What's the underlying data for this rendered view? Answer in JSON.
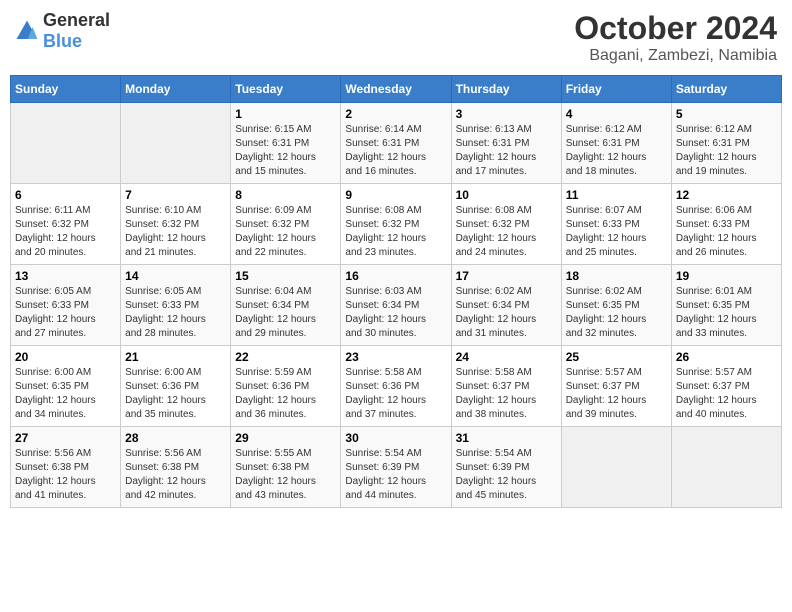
{
  "header": {
    "logo": {
      "text_general": "General",
      "text_blue": "Blue"
    },
    "title": "October 2024",
    "location": "Bagani, Zambezi, Namibia"
  },
  "days_of_week": [
    "Sunday",
    "Monday",
    "Tuesday",
    "Wednesday",
    "Thursday",
    "Friday",
    "Saturday"
  ],
  "weeks": [
    [
      {
        "day": "",
        "detail": ""
      },
      {
        "day": "",
        "detail": ""
      },
      {
        "day": "1",
        "detail": "Sunrise: 6:15 AM\nSunset: 6:31 PM\nDaylight: 12 hours\nand 15 minutes."
      },
      {
        "day": "2",
        "detail": "Sunrise: 6:14 AM\nSunset: 6:31 PM\nDaylight: 12 hours\nand 16 minutes."
      },
      {
        "day": "3",
        "detail": "Sunrise: 6:13 AM\nSunset: 6:31 PM\nDaylight: 12 hours\nand 17 minutes."
      },
      {
        "day": "4",
        "detail": "Sunrise: 6:12 AM\nSunset: 6:31 PM\nDaylight: 12 hours\nand 18 minutes."
      },
      {
        "day": "5",
        "detail": "Sunrise: 6:12 AM\nSunset: 6:31 PM\nDaylight: 12 hours\nand 19 minutes."
      }
    ],
    [
      {
        "day": "6",
        "detail": "Sunrise: 6:11 AM\nSunset: 6:32 PM\nDaylight: 12 hours\nand 20 minutes."
      },
      {
        "day": "7",
        "detail": "Sunrise: 6:10 AM\nSunset: 6:32 PM\nDaylight: 12 hours\nand 21 minutes."
      },
      {
        "day": "8",
        "detail": "Sunrise: 6:09 AM\nSunset: 6:32 PM\nDaylight: 12 hours\nand 22 minutes."
      },
      {
        "day": "9",
        "detail": "Sunrise: 6:08 AM\nSunset: 6:32 PM\nDaylight: 12 hours\nand 23 minutes."
      },
      {
        "day": "10",
        "detail": "Sunrise: 6:08 AM\nSunset: 6:32 PM\nDaylight: 12 hours\nand 24 minutes."
      },
      {
        "day": "11",
        "detail": "Sunrise: 6:07 AM\nSunset: 6:33 PM\nDaylight: 12 hours\nand 25 minutes."
      },
      {
        "day": "12",
        "detail": "Sunrise: 6:06 AM\nSunset: 6:33 PM\nDaylight: 12 hours\nand 26 minutes."
      }
    ],
    [
      {
        "day": "13",
        "detail": "Sunrise: 6:05 AM\nSunset: 6:33 PM\nDaylight: 12 hours\nand 27 minutes."
      },
      {
        "day": "14",
        "detail": "Sunrise: 6:05 AM\nSunset: 6:33 PM\nDaylight: 12 hours\nand 28 minutes."
      },
      {
        "day": "15",
        "detail": "Sunrise: 6:04 AM\nSunset: 6:34 PM\nDaylight: 12 hours\nand 29 minutes."
      },
      {
        "day": "16",
        "detail": "Sunrise: 6:03 AM\nSunset: 6:34 PM\nDaylight: 12 hours\nand 30 minutes."
      },
      {
        "day": "17",
        "detail": "Sunrise: 6:02 AM\nSunset: 6:34 PM\nDaylight: 12 hours\nand 31 minutes."
      },
      {
        "day": "18",
        "detail": "Sunrise: 6:02 AM\nSunset: 6:35 PM\nDaylight: 12 hours\nand 32 minutes."
      },
      {
        "day": "19",
        "detail": "Sunrise: 6:01 AM\nSunset: 6:35 PM\nDaylight: 12 hours\nand 33 minutes."
      }
    ],
    [
      {
        "day": "20",
        "detail": "Sunrise: 6:00 AM\nSunset: 6:35 PM\nDaylight: 12 hours\nand 34 minutes."
      },
      {
        "day": "21",
        "detail": "Sunrise: 6:00 AM\nSunset: 6:36 PM\nDaylight: 12 hours\nand 35 minutes."
      },
      {
        "day": "22",
        "detail": "Sunrise: 5:59 AM\nSunset: 6:36 PM\nDaylight: 12 hours\nand 36 minutes."
      },
      {
        "day": "23",
        "detail": "Sunrise: 5:58 AM\nSunset: 6:36 PM\nDaylight: 12 hours\nand 37 minutes."
      },
      {
        "day": "24",
        "detail": "Sunrise: 5:58 AM\nSunset: 6:37 PM\nDaylight: 12 hours\nand 38 minutes."
      },
      {
        "day": "25",
        "detail": "Sunrise: 5:57 AM\nSunset: 6:37 PM\nDaylight: 12 hours\nand 39 minutes."
      },
      {
        "day": "26",
        "detail": "Sunrise: 5:57 AM\nSunset: 6:37 PM\nDaylight: 12 hours\nand 40 minutes."
      }
    ],
    [
      {
        "day": "27",
        "detail": "Sunrise: 5:56 AM\nSunset: 6:38 PM\nDaylight: 12 hours\nand 41 minutes."
      },
      {
        "day": "28",
        "detail": "Sunrise: 5:56 AM\nSunset: 6:38 PM\nDaylight: 12 hours\nand 42 minutes."
      },
      {
        "day": "29",
        "detail": "Sunrise: 5:55 AM\nSunset: 6:38 PM\nDaylight: 12 hours\nand 43 minutes."
      },
      {
        "day": "30",
        "detail": "Sunrise: 5:54 AM\nSunset: 6:39 PM\nDaylight: 12 hours\nand 44 minutes."
      },
      {
        "day": "31",
        "detail": "Sunrise: 5:54 AM\nSunset: 6:39 PM\nDaylight: 12 hours\nand 45 minutes."
      },
      {
        "day": "",
        "detail": ""
      },
      {
        "day": "",
        "detail": ""
      }
    ]
  ]
}
